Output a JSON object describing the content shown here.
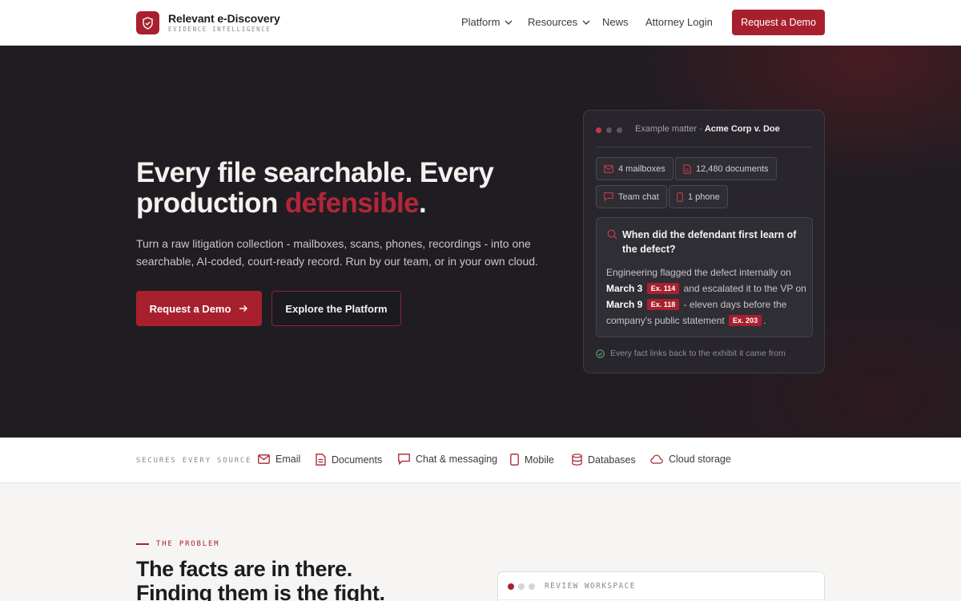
{
  "brand": {
    "name": "Relevant e-Discovery",
    "tagline": "EVIDENCE INTELLIGENCE",
    "accent_color": "#a8202e",
    "logo_icon": "shield-check-icon"
  },
  "nav": {
    "items": [
      {
        "label": "Platform",
        "has_dropdown": true
      },
      {
        "label": "Resources",
        "has_dropdown": true
      },
      {
        "label": "News",
        "has_dropdown": false
      },
      {
        "label": "Attorney Login",
        "has_dropdown": false
      }
    ],
    "cta": "Request a Demo"
  },
  "hero": {
    "title_part1": "Every file searchable. Every production ",
    "title_accent": "defensible",
    "title_end": ".",
    "subtitle": "Turn a raw litigation collection - mailboxes, scans, phones, recordings - into one searchable, AI-coded, court-ready record. Run by our team, or in your own cloud.",
    "primary_cta": "Request a Demo",
    "secondary_cta": "Explore the Platform"
  },
  "example_card": {
    "matter_label": "Example matter",
    "matter_sep": "·",
    "matter_name": "Acme Corp v. Doe",
    "chips": [
      {
        "icon": "mail-icon",
        "label": "4 mailboxes"
      },
      {
        "icon": "document-icon",
        "label": "12,480 documents"
      },
      {
        "icon": "chat-icon",
        "label": "Team chat"
      },
      {
        "icon": "phone-icon",
        "label": "1 phone"
      }
    ],
    "question": "When did the defendant first learn of the defect?",
    "answer": {
      "t1": "Engineering flagged the defect internally on ",
      "d1": "March 3",
      "ex1": "Ex. 114",
      "t2": " and escalated it to the VP on ",
      "d2": "March 9",
      "ex2": "Ex. 118",
      "t3": " - eleven days before the company's public statement",
      "ex3": "Ex. 203",
      "t4": "."
    },
    "footer": "Every fact links back to the exhibit it came from"
  },
  "sources": {
    "label": "SECURES EVERY SOURCE",
    "items": [
      {
        "icon": "mail-icon",
        "label": "Email"
      },
      {
        "icon": "document-icon",
        "label": "Documents"
      },
      {
        "icon": "chat-icon",
        "label": "Chat & messaging"
      },
      {
        "icon": "phone-icon",
        "label": "Mobile"
      },
      {
        "icon": "database-icon",
        "label": "Databases"
      },
      {
        "icon": "cloud-icon",
        "label": "Cloud storage"
      }
    ]
  },
  "problem": {
    "eyebrow": "THE PROBLEM",
    "title_line1": "The facts are in there.",
    "title_line2": "Finding them is the fight.",
    "workspace_label": "REVIEW WORKSPACE"
  }
}
